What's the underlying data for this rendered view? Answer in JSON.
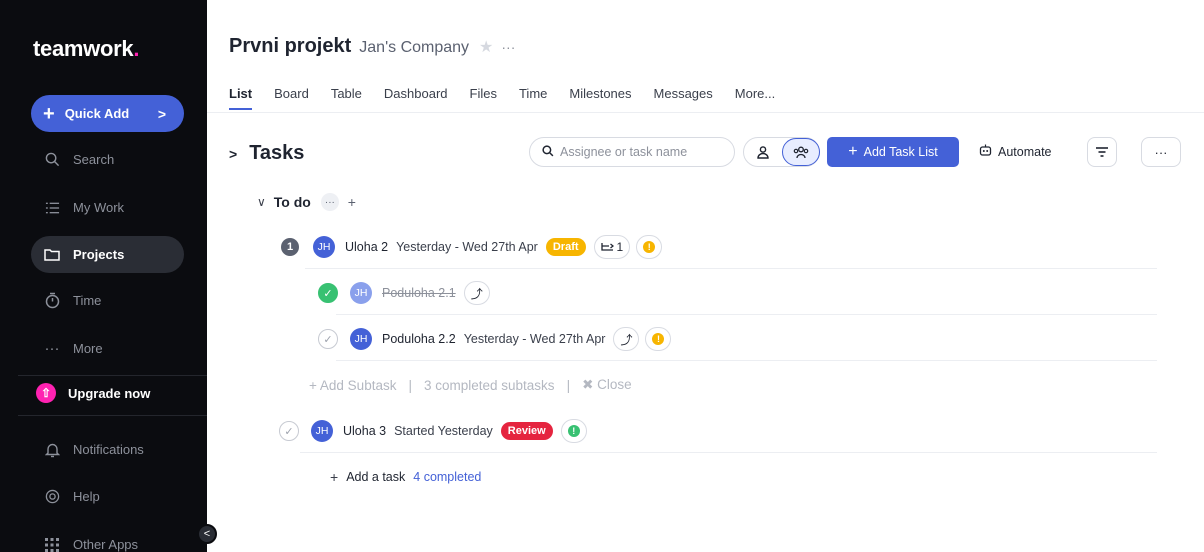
{
  "sidebar": {
    "logo": "teamwork",
    "logo_dot": ".",
    "quick_add": "Quick Add",
    "items": [
      {
        "label": "Search",
        "icon": "search-icon"
      },
      {
        "label": "My Work",
        "icon": "my-work-icon"
      },
      {
        "label": "Projects",
        "icon": "folder-icon",
        "active": true
      },
      {
        "label": "Time",
        "icon": "stopwatch-icon"
      },
      {
        "label": "More",
        "icon": "more-dots-icon"
      }
    ],
    "upgrade": "Upgrade now",
    "bottom_items": [
      {
        "label": "Notifications",
        "icon": "bell-icon"
      },
      {
        "label": "Help",
        "icon": "help-icon"
      },
      {
        "label": "Other Apps",
        "icon": "apps-grid-icon"
      }
    ]
  },
  "header": {
    "project_title": "Prvni projekt",
    "company": "Jan's Company",
    "tabs": [
      "List",
      "Board",
      "Table",
      "Dashboard",
      "Files",
      "Time",
      "Milestones",
      "Messages",
      "More..."
    ]
  },
  "toolbar": {
    "section_title": "Tasks",
    "search_placeholder": "Assignee or task name",
    "add_task_list": "Add Task List",
    "automate": "Automate"
  },
  "group": {
    "name": "To do",
    "tasks": [
      {
        "name": "Uloha 2",
        "date": "Yesterday - Wed 27th Apr",
        "tag": "Draft",
        "subtask_count": "1",
        "avatar": "JH",
        "count": "1"
      },
      {
        "name": "Poduloha 2.1",
        "avatar": "JH"
      },
      {
        "name": "Poduloha 2.2",
        "date": "Yesterday - Wed 27th Apr",
        "avatar": "JH"
      },
      {
        "name": "Uloha 3",
        "date": "Started Yesterday",
        "tag": "Review",
        "avatar": "JH"
      }
    ],
    "subtask_actions": {
      "add": "Add Subtask",
      "completed": "3 completed subtasks",
      "close": "Close"
    },
    "add_task": "Add a task",
    "completed": "4 completed"
  },
  "colors": {
    "accent": "#4461d7",
    "brand_pink": "#ff22b1",
    "draft": "#f7b500",
    "review": "#e5243f",
    "done": "#38c172"
  }
}
